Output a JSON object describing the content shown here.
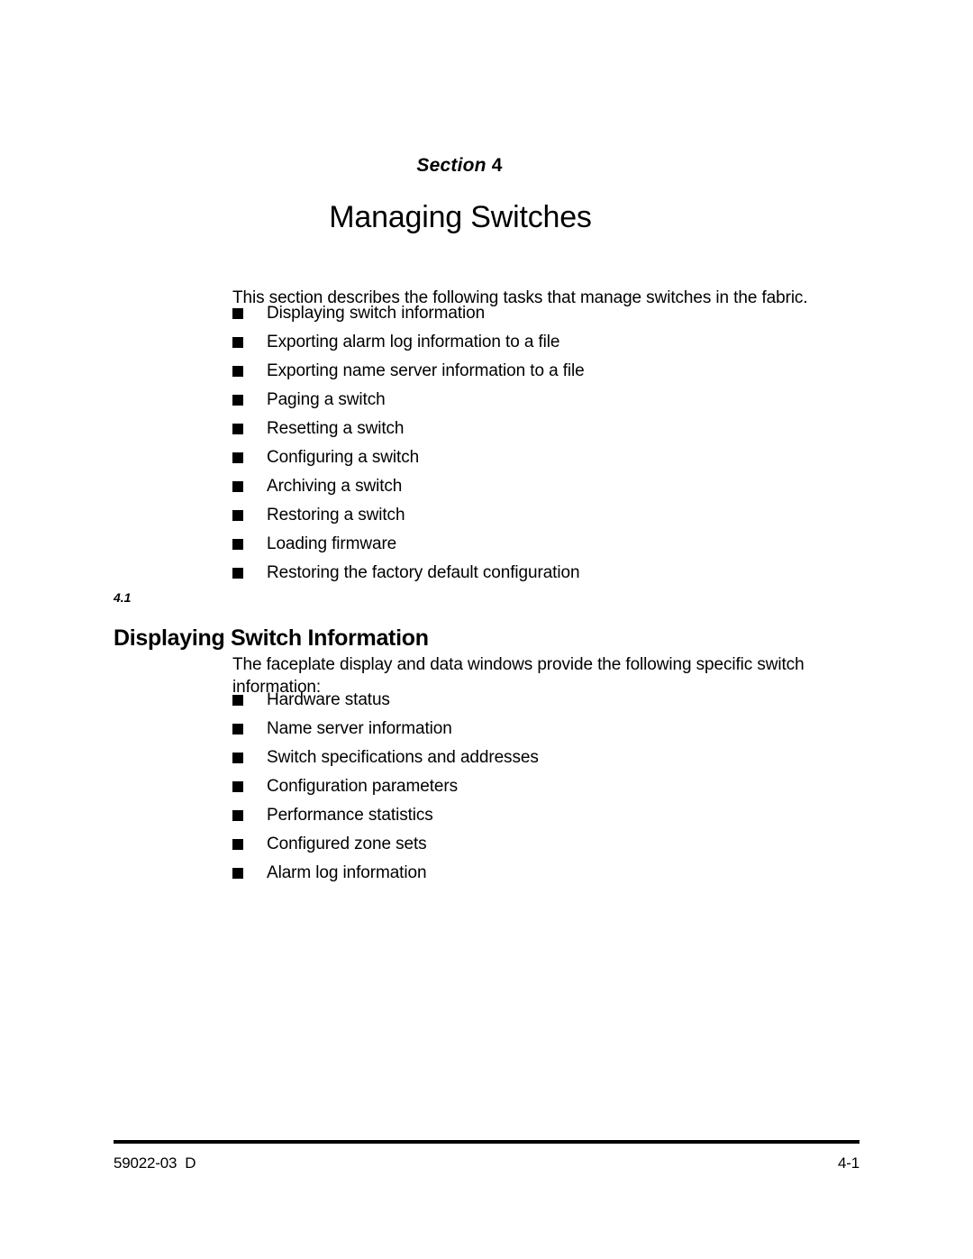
{
  "document": {
    "section_label_prefix": "Section",
    "section_label_number": "4",
    "chapter_title": "Managing Switches"
  },
  "intro": {
    "paragraph": "This section describes the following tasks that manage switches in the fabric.",
    "bullets": [
      "Displaying switch information",
      "Exporting alarm log information to a file",
      "Exporting name server information to a file",
      "Paging a switch",
      "Resetting a switch",
      "Configuring a switch",
      "Archiving a switch",
      "Restoring a switch",
      "Loading firmware",
      "Restoring the factory default configuration"
    ]
  },
  "section_4_1": {
    "number": "4.1",
    "heading": "Displaying Switch Information",
    "paragraph": "The faceplate display and data windows provide the following specific switch information:",
    "bullets": [
      "Hardware status",
      "Name server information",
      "Switch specifications and addresses",
      "Configuration parameters",
      "Performance statistics",
      "Configured zone sets",
      "Alarm log information"
    ]
  },
  "footer": {
    "document_number": "59022-03  D",
    "page_number": "4-1"
  }
}
